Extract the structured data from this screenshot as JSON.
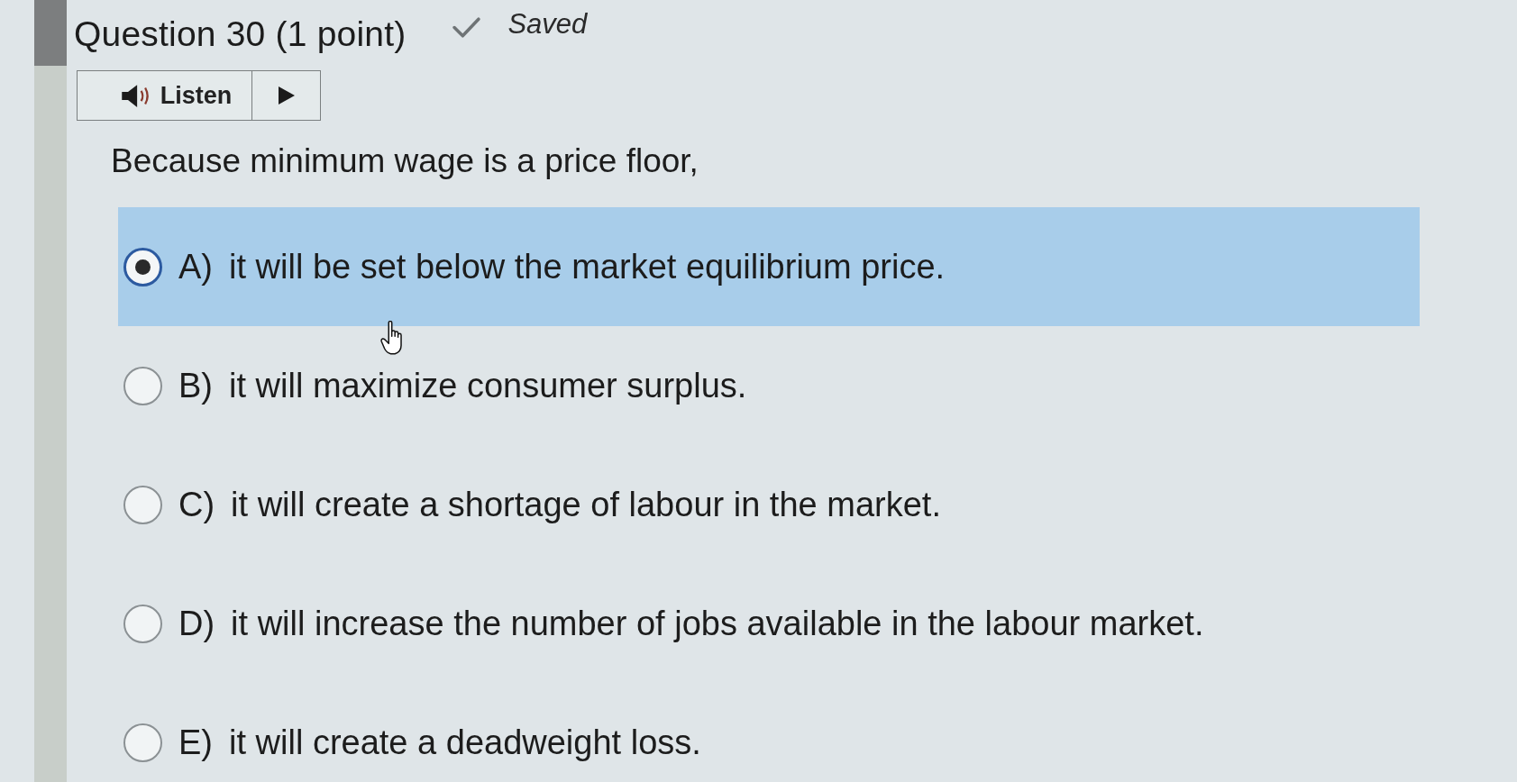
{
  "header": {
    "title": "Question 30 (1 point)",
    "save_status": "Saved"
  },
  "listen": {
    "label": "Listen"
  },
  "question": {
    "text": "Because minimum wage is a price floor,"
  },
  "options": [
    {
      "letter": "A)",
      "text": "it will be set below the market equilibrium price.",
      "selected": true
    },
    {
      "letter": "B)",
      "text": "it will maximize consumer surplus.",
      "selected": false
    },
    {
      "letter": "C)",
      "text": "it will create a shortage of labour in the market.",
      "selected": false
    },
    {
      "letter": "D)",
      "text": "it will increase the number of jobs available in the labour market.",
      "selected": false
    },
    {
      "letter": "E)",
      "text": "it will create a deadweight loss.",
      "selected": false
    }
  ]
}
